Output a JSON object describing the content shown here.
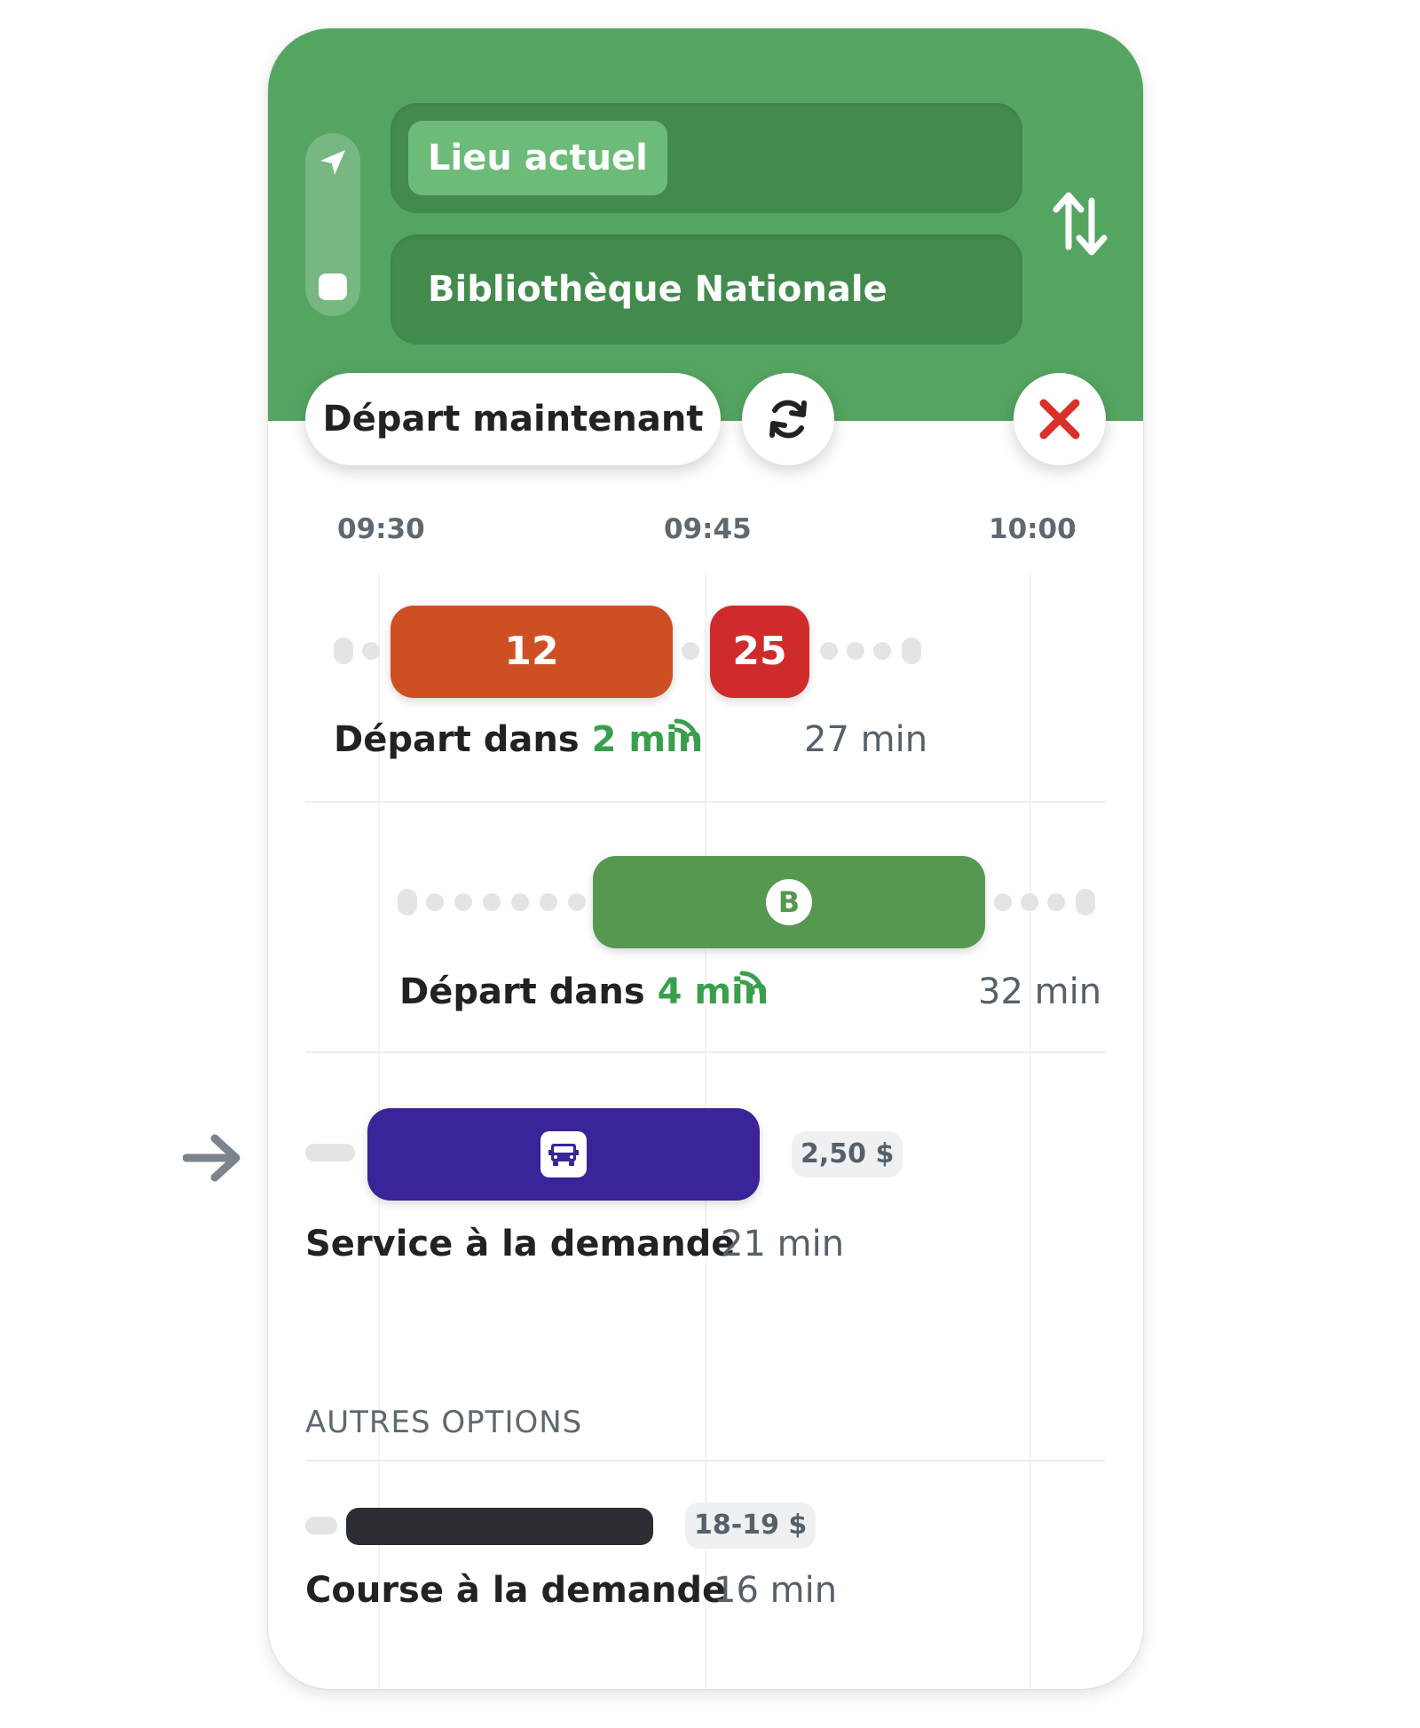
{
  "search": {
    "origin_label": "Lieu actuel",
    "destination": "Bibliothèque Nationale",
    "depart_button": "Départ maintenant"
  },
  "timeline": {
    "labels": [
      "09:30",
      "09:45",
      "10:00"
    ]
  },
  "routes": [
    {
      "segments": [
        {
          "label": "12",
          "color": "#cf4f24"
        },
        {
          "label": "25",
          "color": "#cf2b2b"
        }
      ],
      "prefix": "Départ dans",
      "minutes": "2 min",
      "duration": "27 min"
    },
    {
      "segments": [
        {
          "label": "B",
          "color": "#56984f"
        }
      ],
      "prefix": "Départ dans",
      "minutes": "4 min",
      "duration": "32 min"
    },
    {
      "segments": [
        {
          "icon": "bus-icon",
          "color": "#3b2399"
        }
      ],
      "title": "Service à la demande",
      "duration": "21 min",
      "price": "2,50 $"
    }
  ],
  "other_options": {
    "header": "AUTRES OPTIONS",
    "items": [
      {
        "title": "Course à la demande",
        "duration": "16 min",
        "price": "18-19 $",
        "color": "#2b2e33"
      }
    ]
  },
  "colors": {
    "header_green": "#55a562",
    "field_green": "#438a4d",
    "chip_green": "#6dbb79",
    "realtime_green": "#3a9f4c",
    "close_red": "#d9302a"
  }
}
